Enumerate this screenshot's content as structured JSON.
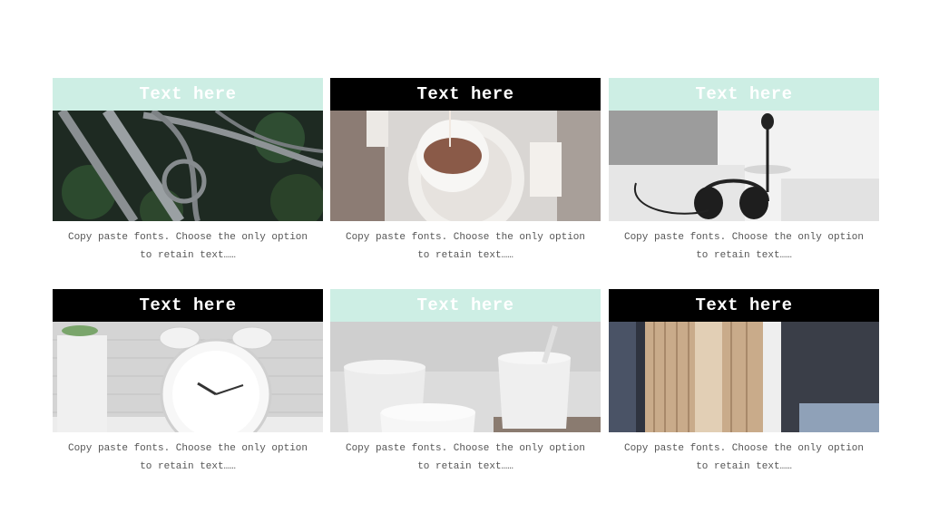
{
  "cards": [
    {
      "title": "Text here",
      "caption_line1": "Copy paste fonts. Choose the only option",
      "caption_line2": "to retain text……",
      "image": "aerial-highway-interchange"
    },
    {
      "title": "Text here",
      "caption_line1": "Copy paste fonts. Choose the only option",
      "caption_line2": "to retain text……",
      "image": "tea-cup-on-saucer"
    },
    {
      "title": "Text here",
      "caption_line1": "Copy paste fonts. Choose the only option",
      "caption_line2": "to retain text……",
      "image": "headset-and-keyboard"
    },
    {
      "title": "Text here",
      "caption_line1": "Copy paste fonts. Choose the only option",
      "caption_line2": "to retain text……",
      "image": "alarm-clock"
    },
    {
      "title": "Text here",
      "caption_line1": "Copy paste fonts. Choose the only option",
      "caption_line2": "to retain text……",
      "image": "white-cups"
    },
    {
      "title": "Text here",
      "caption_line1": "Copy paste fonts. Choose the only option",
      "caption_line2": "to retain text……",
      "image": "open-book"
    }
  ],
  "colors": {
    "mint": "#cdeee4",
    "dark": "#000000",
    "caption": "#555555"
  }
}
